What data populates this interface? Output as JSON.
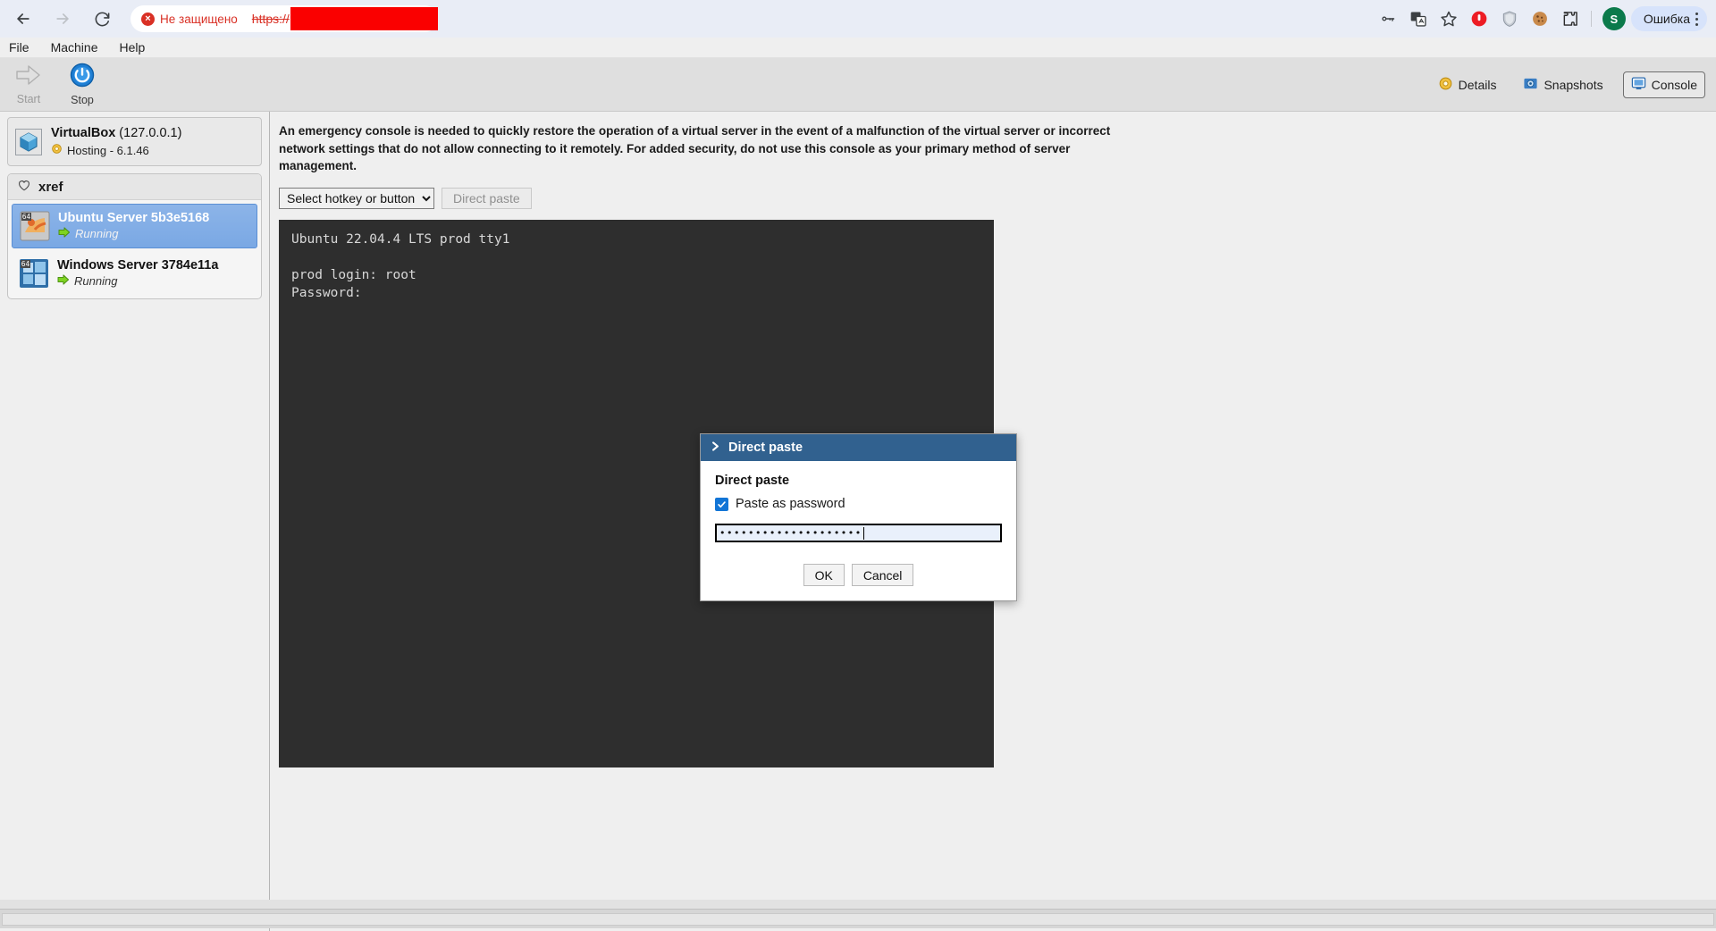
{
  "browser": {
    "back_label": "back-arrow",
    "forward_label": "forward-arrow",
    "reload_label": "reload",
    "security": {
      "icon": "not-secure-icon",
      "badge_text": "!",
      "label": "Не защищено"
    },
    "url": {
      "scheme": "https://",
      "redacted": ""
    },
    "right_icons": [
      {
        "name": "password-key-icon",
        "label": "key"
      },
      {
        "name": "translate-icon",
        "label": "translate"
      },
      {
        "name": "bookmark-star-icon",
        "label": "star"
      },
      {
        "name": "extension-adblock-icon",
        "label": "adblock"
      },
      {
        "name": "extension-shield-icon",
        "label": "shield"
      },
      {
        "name": "extension-cookie-icon",
        "label": "cookie"
      },
      {
        "name": "extensions-puzzle-icon",
        "label": "extensions"
      }
    ],
    "profile_initial": "S",
    "error_chip_label": "Ошибка",
    "accent_red": "#d93025",
    "accent_blue": "#d7e3fb"
  },
  "app": {
    "menubar": [
      {
        "label": "File"
      },
      {
        "label": "Machine"
      },
      {
        "label": "Help"
      }
    ],
    "toolbar": [
      {
        "label": "Start",
        "icon": "start-arrow-icon",
        "enabled": false
      },
      {
        "label": "Stop",
        "icon": "stop-power-icon",
        "enabled": true
      }
    ],
    "tabs": [
      {
        "label": "Details",
        "icon": "details-gear-icon",
        "active": false
      },
      {
        "label": "Snapshots",
        "icon": "snapshots-camera-icon",
        "active": false
      },
      {
        "label": "Console",
        "icon": "console-monitor-icon",
        "active": true
      }
    ]
  },
  "sidebar": {
    "host": {
      "icon": "virtualbox-cube-icon",
      "name": "VirtualBox",
      "address": "(127.0.0.1)",
      "status_icon": "gear-icon",
      "status": "Hosting - 6.1.46"
    },
    "group": {
      "icon": "heart-icon",
      "label": "xref"
    },
    "machines": [
      {
        "icon": "ubuntu-64-icon",
        "name": "Ubuntu Server 5b3e5168",
        "state_icon": "running-arrow-icon",
        "state": "Running",
        "selected": true
      },
      {
        "icon": "windows-64-icon",
        "name": "Windows Server 3784e11a",
        "state_icon": "running-arrow-icon",
        "state": "Running",
        "selected": false
      }
    ]
  },
  "content": {
    "notice": "An emergency console is needed to quickly restore the operation of a virtual server in the event of a malfunction of the virtual server or incorrect network settings that do not allow connecting to it remotely. For added security, do not use this console as your primary method of server management.",
    "hotkey_select": {
      "selected": "Select hotkey or button",
      "options": [
        "Select hotkey or button"
      ]
    },
    "direct_paste_button": "Direct paste",
    "terminal": {
      "lines": [
        "Ubuntu 22.04.4 LTS prod tty1",
        "",
        "prod login: root",
        "Password:"
      ],
      "background": "#2e2e2e",
      "foreground": "#d8d8d8"
    }
  },
  "modal": {
    "titlebar_icon": "chevron-right-icon",
    "title": "Direct paste",
    "section_title": "Direct paste",
    "checkbox": {
      "name": "paste-as-password-checkbox",
      "label": "Paste as password",
      "checked": true
    },
    "password_field": {
      "masked_value": "••••••••••••••••••••",
      "placeholder": ""
    },
    "ok_button": "OK",
    "cancel_button": "Cancel",
    "header_color": "#31618f"
  }
}
